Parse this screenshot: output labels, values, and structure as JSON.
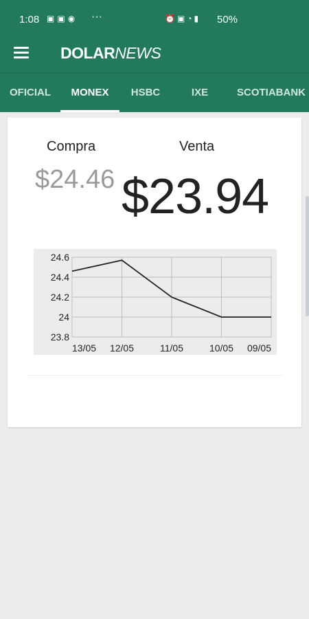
{
  "status": {
    "time": "1:08",
    "left_icons": [
      "image-icon",
      "photo-icon",
      "circle-icon"
    ],
    "dots": "···",
    "right_icons": [
      "alarm-icon",
      "nfc-icon",
      "wifi-icon",
      "signal-icon"
    ],
    "battery": "50%"
  },
  "app": {
    "logo_bold": "DOLAR",
    "logo_italic": "NEWS"
  },
  "tabs": [
    {
      "label": "OFICIAL"
    },
    {
      "label": "MONEX"
    },
    {
      "label": "HSBC"
    },
    {
      "label": "IXE"
    },
    {
      "label": "SCOTIABANK"
    }
  ],
  "active_tab": "MONEX",
  "rates": {
    "compra_label": "Compra",
    "venta_label": "Venta",
    "compra_value": "$24.46",
    "venta_value": "$23.94"
  },
  "chart_data": {
    "type": "line",
    "categories": [
      "13/05",
      "12/05",
      "11/05",
      "10/05",
      "09/05"
    ],
    "values": [
      24.46,
      24.57,
      24.2,
      24.0,
      24.0
    ],
    "ylim": [
      23.8,
      24.6
    ],
    "yticks": [
      "24.6",
      "24.4",
      "24.2",
      "24",
      "23.8"
    ],
    "grid": true,
    "title": "",
    "xlabel": "",
    "ylabel": ""
  }
}
